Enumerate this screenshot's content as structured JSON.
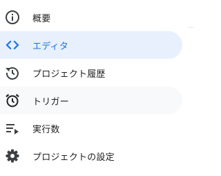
{
  "nav": {
    "items": [
      {
        "label": "概要",
        "icon": "info-icon",
        "state": "normal"
      },
      {
        "label": "エディタ",
        "icon": "code-brackets-icon",
        "state": "active"
      },
      {
        "label": "プロジェクト履歴",
        "icon": "history-icon",
        "state": "normal"
      },
      {
        "label": "トリガー",
        "icon": "alarm-clock-icon",
        "state": "hover"
      },
      {
        "label": "実行数",
        "icon": "executions-icon",
        "state": "normal"
      },
      {
        "label": "プロジェクトの設定",
        "icon": "gear-icon",
        "state": "normal"
      }
    ]
  },
  "colors": {
    "active_bg": "#e8f0fe",
    "active_fg": "#1a73e8",
    "hover_bg": "#f8f9fa",
    "icon": "#3c4043",
    "text": "#202124"
  }
}
